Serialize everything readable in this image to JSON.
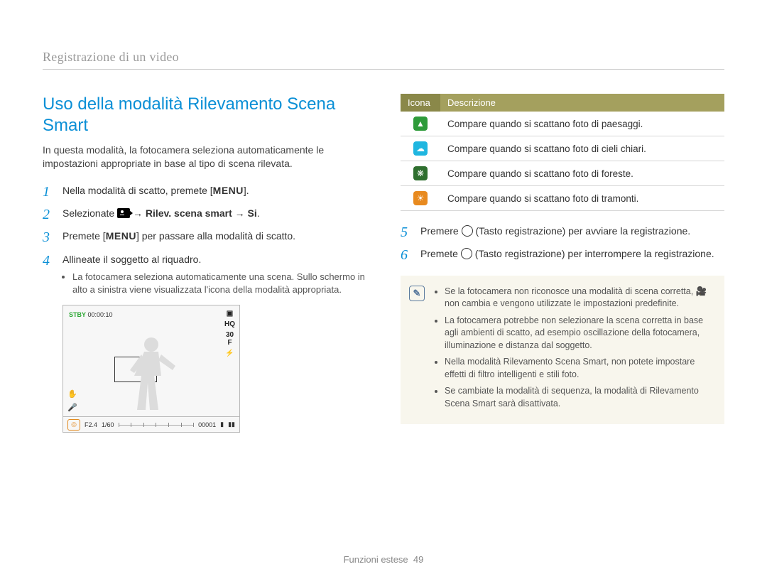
{
  "section_title": "Registrazione di un video",
  "heading": "Uso della modalità Rilevamento Scena Smart",
  "intro": "In questa modalità, la fotocamera seleziona automaticamente le impostazioni appropriate in base al tipo di scena rilevata.",
  "steps_left": [
    {
      "num": "1",
      "pre": "Nella modalità di scatto, premete [",
      "mid_menu": "MENU",
      "post": "]."
    },
    {
      "num": "2",
      "pre": "Selezionate ",
      "video_icon": true,
      "arrow1": " → ",
      "bold1": "Rilev. scena smart",
      "arrow2": " → ",
      "bold2": "Si",
      "post": "."
    },
    {
      "num": "3",
      "pre": "Premete [",
      "mid_menu": "MENU",
      "post": "] per passare alla modalità di scatto."
    },
    {
      "num": "4",
      "pre": "Allineate il soggetto al riquadro.",
      "sub": "La fotocamera seleziona automaticamente una scena. Sullo schermo in alto a sinistra viene visualizzata l'icona della modalità appropriata."
    }
  ],
  "preview": {
    "stby_label": "STBY",
    "stby_time": "00:00:10",
    "fvalue": "F2.4",
    "shutter": "1/60",
    "counter": "00001"
  },
  "table": {
    "col_icon": "Icona",
    "col_desc": "Descrizione",
    "rows": [
      {
        "color": "c-green",
        "glyph": "▲",
        "desc": "Compare quando si scattano foto di paesaggi."
      },
      {
        "color": "c-cyan",
        "glyph": "☁",
        "desc": "Compare quando si scattano foto di cieli chiari."
      },
      {
        "color": "c-dgreen",
        "glyph": "❋",
        "desc": "Compare quando si scattano foto di foreste."
      },
      {
        "color": "c-orange",
        "glyph": "☀",
        "desc": "Compare quando si scattano foto di tramonti."
      }
    ]
  },
  "steps_right": [
    {
      "num": "5",
      "pre": "Premere ",
      "rec": true,
      "post": " (Tasto registrazione) per avviare la registrazione."
    },
    {
      "num": "6",
      "pre": "Premete ",
      "rec": true,
      "post": " (Tasto registrazione) per interrompere la registrazione."
    }
  ],
  "notes": [
    "Se la fotocamera non riconosce una modalità di scena corretta, 🎥 non cambia e vengono utilizzate le impostazioni predefinite.",
    "La fotocamera potrebbe non selezionare la scena corretta in base agli ambienti di scatto, ad esempio oscillazione della fotocamera, illuminazione e distanza dal soggetto.",
    "Nella modalità Rilevamento Scena Smart, non potete impostare effetti di filtro intelligenti e stili foto.",
    "Se cambiate la modalità di sequenza, la modalità di Rilevamento Scena Smart sarà disattivata."
  ],
  "footer_section": "Funzioni estese",
  "footer_page": "49"
}
